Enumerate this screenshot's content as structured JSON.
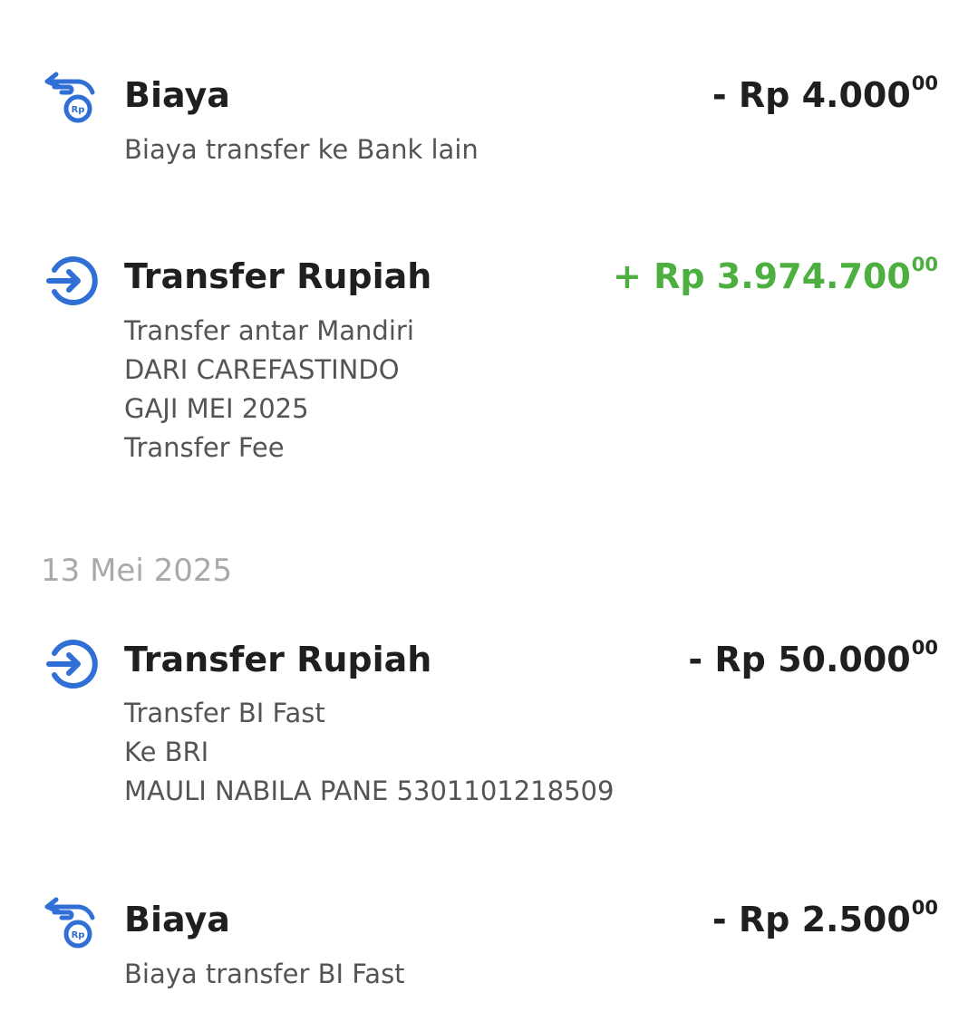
{
  "colors": {
    "icon_blue": "#2f6fd6",
    "credit_green": "#4caf3f",
    "text_dark": "#1f1f1f",
    "text_muted": "#545454",
    "date_gray": "#a9a9a9"
  },
  "transactions_top": [
    {
      "icon": "fee-hand-coin-icon",
      "title": "Biaya",
      "amount_main": "- Rp 4.000",
      "amount_cents": "00",
      "direction": "debit",
      "details": [
        "Biaya transfer ke Bank lain"
      ]
    },
    {
      "icon": "transfer-arrow-icon",
      "title": "Transfer Rupiah",
      "amount_main": "+ Rp 3.974.700",
      "amount_cents": "00",
      "direction": "credit",
      "details": [
        "Transfer antar Mandiri",
        "DARI CAREFASTINDO",
        "GAJI MEI 2025",
        "Transfer Fee"
      ]
    }
  ],
  "date_group": {
    "date": "13 Mei 2025",
    "transactions": [
      {
        "icon": "transfer-arrow-icon",
        "title": "Transfer Rupiah",
        "amount_main": "- Rp 50.000",
        "amount_cents": "00",
        "direction": "debit",
        "details": [
          "Transfer BI Fast",
          "Ke BRI",
          "MAULI NABILA PANE 5301101218509"
        ]
      },
      {
        "icon": "fee-hand-coin-icon",
        "title": "Biaya",
        "amount_main": "- Rp 2.500",
        "amount_cents": "00",
        "direction": "debit",
        "details": [
          "Biaya transfer BI Fast"
        ]
      }
    ]
  }
}
